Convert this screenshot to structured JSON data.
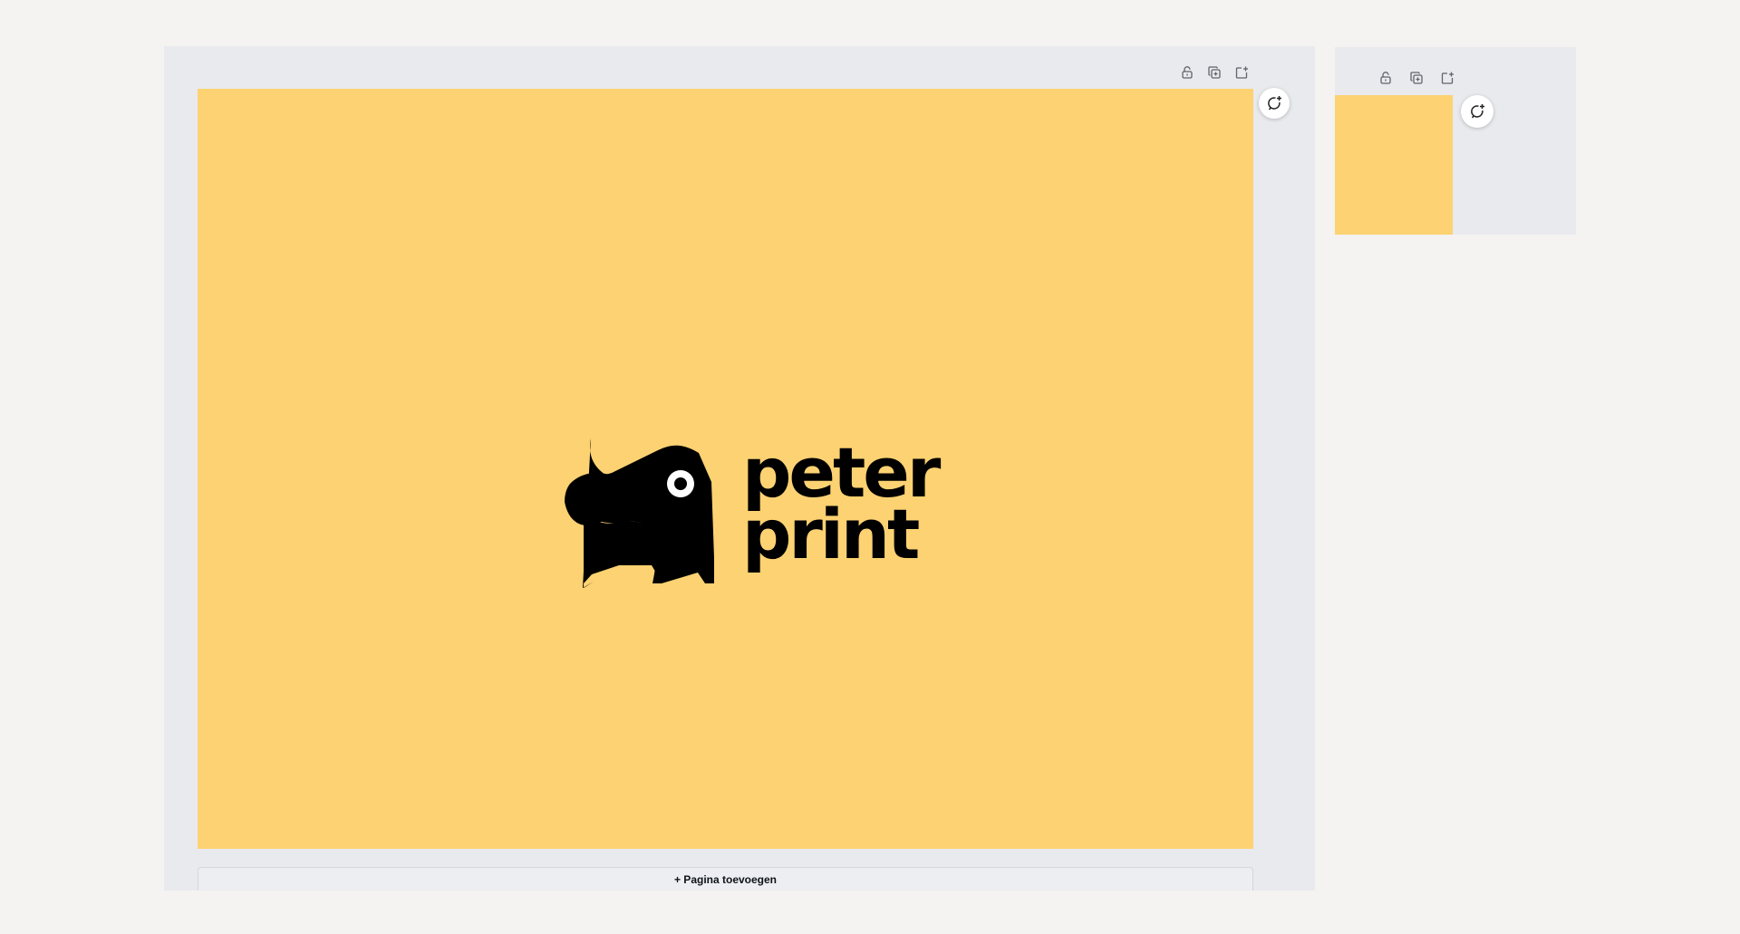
{
  "main_page": {
    "toolbar": {
      "lock_icon": "lock-open-icon",
      "duplicate_icon": "duplicate-icon",
      "add_page_icon": "add-page-icon"
    },
    "comment_icon": "add-comment-icon",
    "background_color": "#fcd272",
    "logo": {
      "line1": "peter",
      "line2": "print",
      "color": "#000000"
    },
    "add_page_label": "+ Pagina toevoegen"
  },
  "side_page": {
    "toolbar": {
      "lock_icon": "lock-open-icon",
      "duplicate_icon": "duplicate-icon",
      "add_page_icon": "add-page-icon"
    },
    "comment_icon": "add-comment-icon",
    "background_color": "#fcd272"
  },
  "colors": {
    "canvas_background": "#f4f3f2",
    "editor_panel": "#e9eaee",
    "page_yellow": "#fcd272"
  }
}
